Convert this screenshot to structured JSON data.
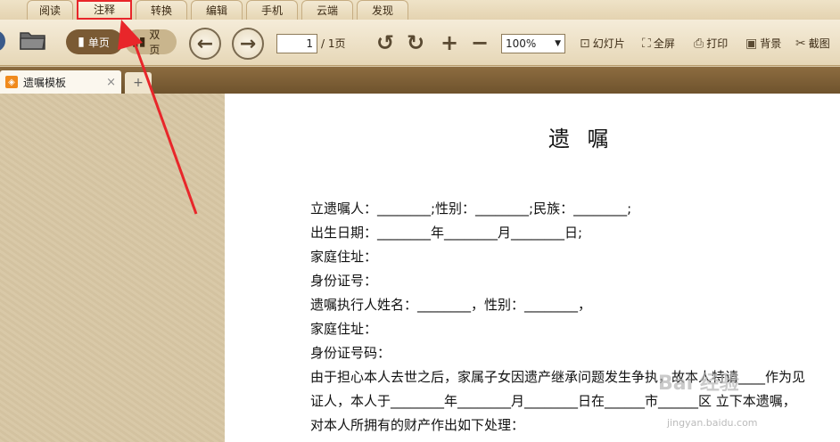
{
  "menu": {
    "tabs": [
      {
        "label": "阅读"
      },
      {
        "label": "注释"
      },
      {
        "label": "转换"
      },
      {
        "label": "编辑"
      },
      {
        "label": "手机"
      },
      {
        "label": "云端"
      },
      {
        "label": "发现"
      }
    ]
  },
  "toolbar": {
    "single_label": "单页",
    "double_label": "双页",
    "page_value": "1",
    "page_total": "/ 1页",
    "zoom_value": "100%",
    "slideshow_label": "幻灯片",
    "fullscreen_label": "全屏",
    "print_label": "打印",
    "background_label": "背景",
    "screenshot_label": "截图"
  },
  "doc_tab": {
    "title": "遗嘱模板",
    "close": "×",
    "new": "+"
  },
  "document": {
    "title": "遗 嘱",
    "lines": [
      "立遗嘱人：________;性别：________;民族：________;",
      "出生日期：________年________月________日;",
      "家庭住址：",
      "身份证号：",
      "遗嘱执行人姓名：________，性别：________，",
      "家庭住址：",
      "身份证号码：",
      "由于担心本人去世之后，家属子女因遗产继承问题发生争执，故本人特请____作为见",
      "证人，本人于________年________月________日在______市______区 立下本遗嘱，",
      "对本人所拥有的财产作出如下处理："
    ]
  },
  "watermark": {
    "main": "Bai 经验",
    "sub": "jingyan.baidu.com"
  },
  "colors": {
    "highlight": "#e8262a",
    "menubar": "#e4d3b0",
    "docstrip": "#7a5a34"
  }
}
